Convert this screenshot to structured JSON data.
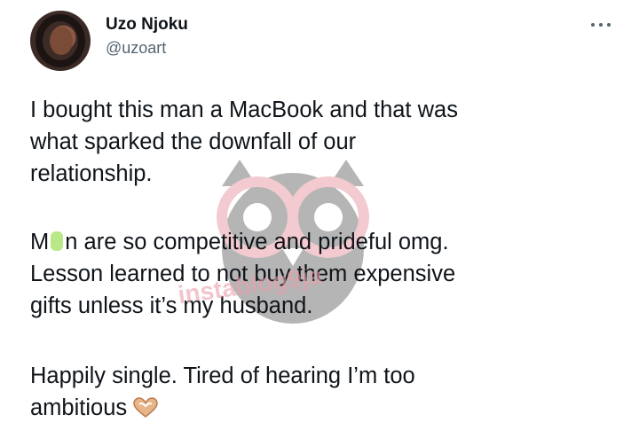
{
  "user": {
    "display_name": "Uzo Njoku",
    "handle": "@uzoart"
  },
  "tweet": {
    "paragraph1": [
      "I bought this man a MacBook and that was",
      "what sparked the downfall of our",
      "relationship."
    ],
    "paragraph2_line1_start": "M",
    "paragraph2_line1_end": "n are so competitive and prideful omg.",
    "paragraph2": [
      "Lesson learned to not buy them expensive",
      "gifts unless it’s my husband."
    ],
    "paragraph3": [
      "Happily single. Tired of hearing I’m too",
      "ambitious"
    ]
  },
  "watermark": {
    "text": "instablog9ja"
  },
  "icons": {
    "more": "more-horizontal-icon",
    "emoji": "heart-hands-icon"
  },
  "colors": {
    "text": "#0f1419",
    "secondary": "#536471",
    "highlight": "#b8e986",
    "watermark_pink": "#e8a0aa"
  }
}
